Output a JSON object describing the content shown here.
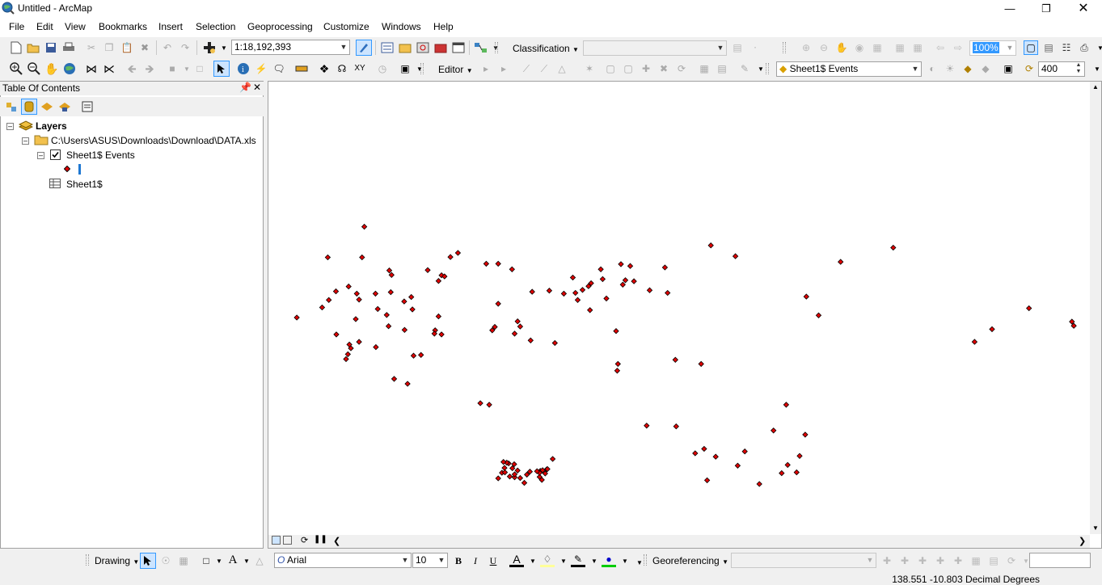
{
  "window": {
    "title": "Untitled - ArcMap",
    "minimize_icon": "minimize-icon",
    "restore_icon": "restore-icon",
    "close_icon": "close-icon"
  },
  "menu": [
    "File",
    "Edit",
    "View",
    "Bookmarks",
    "Insert",
    "Selection",
    "Geoprocessing",
    "Customize",
    "Windows",
    "Help"
  ],
  "standard_toolbar": {
    "scale": "1:18,192,393"
  },
  "spatial_adjustment": {
    "classification_label": "Classification",
    "georef_zoom": "100%"
  },
  "editor": {
    "label": "Editor"
  },
  "effects": {
    "layer": "Sheet1$ Events",
    "value": "400"
  },
  "toc": {
    "title": "Table Of Contents",
    "root": "Layers",
    "source_path": "C:\\Users\\ASUS\\Downloads\\Download\\DATA.xls",
    "layer": "Sheet1$ Events",
    "table": "Sheet1$"
  },
  "drawing": {
    "label": "Drawing",
    "font": "Arial",
    "size": "10",
    "bold": "B",
    "italic": "I",
    "underline": "U",
    "font_color_glyph": "A"
  },
  "georef": {
    "label": "Georeferencing"
  },
  "status": {
    "coordinates": "138.551  -10.803 Decimal Degrees"
  },
  "colors": {
    "point_fill": "#e00000",
    "point_stroke": "#000000",
    "highlight": "#3399ff"
  },
  "map_points": [
    [
      -124.3,
      49.2
    ],
    [
      -134.1,
      41.0
    ],
    [
      -124.9,
      41.0
    ],
    [
      -91.6,
      39.3
    ],
    [
      -88.4,
      39.3
    ],
    [
      -84.7,
      37.8
    ],
    [
      -60.9,
      37.8
    ],
    [
      -103.6,
      36.2
    ],
    [
      -102.8,
      35.9
    ],
    [
      -117.6,
      37.5
    ],
    [
      -107.3,
      37.6
    ],
    [
      -117.0,
      36.3
    ],
    [
      -55.0,
      33.7
    ],
    [
      -104.4,
      34.7
    ],
    [
      -128.5,
      33.2
    ],
    [
      -126.3,
      31.3
    ],
    [
      -131.9,
      31.9
    ],
    [
      -133.8,
      29.6
    ],
    [
      -121.3,
      31.3
    ],
    [
      -117.2,
      31.7
    ],
    [
      -125.7,
      29.7
    ],
    [
      -111.7,
      30.4
    ],
    [
      -113.6,
      29.2
    ],
    [
      -88.4,
      28.6
    ],
    [
      -142.4,
      24.9
    ],
    [
      -126.6,
      24.5
    ],
    [
      -135.6,
      27.6
    ],
    [
      -120.7,
      27.2
    ],
    [
      -118.3,
      25.6
    ],
    [
      -111.4,
      27.1
    ],
    [
      -104.4,
      25.2
    ],
    [
      -117.8,
      22.6
    ],
    [
      -113.5,
      21.6
    ],
    [
      -105.3,
      21.5
    ],
    [
      -105.5,
      20.6
    ],
    [
      -103.6,
      20.4
    ],
    [
      -82.5,
      22.5
    ],
    [
      -89.3,
      22.4
    ],
    [
      -83.2,
      23.9
    ],
    [
      -131.8,
      20.4
    ],
    [
      -125.7,
      18.4
    ],
    [
      -128.7,
      15.1
    ],
    [
      -109.1,
      14.9
    ],
    [
      -111.1,
      14.7
    ],
    [
      -128.3,
      17.7
    ],
    [
      -127.9,
      16.7
    ],
    [
      -121.2,
      17.0
    ],
    [
      -79.3,
      31.8
    ],
    [
      -74.7,
      32.1
    ],
    [
      -54.3,
      34.9
    ],
    [
      -73.2,
      18.1
    ],
    [
      -67.7,
      31.5
    ],
    [
      -56.5,
      10.7
    ],
    [
      -90.0,
      21.5
    ],
    [
      -84.0,
      20.6
    ],
    [
      -79.7,
      18.8
    ],
    [
      -64.2,
      33.3
    ],
    [
      -99.2,
      42.2
    ],
    [
      -101.2,
      41.1
    ],
    [
      -53.0,
      38.7
    ],
    [
      -43.7,
      38.3
    ],
    [
      -24.8,
      41.3
    ],
    [
      -60.4,
      35.2
    ],
    [
      -56.3,
      12.5
    ],
    [
      -63.5,
      34.1
    ],
    [
      -43.0,
      31.5
    ],
    [
      -52.0,
      34.6
    ],
    [
      -68.4,
      35.6
    ],
    [
      -65.8,
      32.3
    ],
    [
      -67.1,
      29.6
    ],
    [
      -63.8,
      26.9
    ],
    [
      -56.8,
      21.3
    ],
    [
      -129.2,
      13.8
    ],
    [
      -116.3,
      8.5
    ],
    [
      -112.7,
      7.2
    ],
    [
      -93.2,
      2.0
    ],
    [
      -90.8,
      1.6
    ],
    [
      -34.0,
      12.5
    ],
    [
      -48.6,
      -4.0
    ],
    [
      -35.6,
      -11.4
    ],
    [
      -30.1,
      -12.3
    ],
    [
      -32.4,
      -18.6
    ],
    [
      -18.4,
      -19.6
    ],
    [
      -10.8,
      -14.5
    ],
    [
      -12.4,
      -16.7
    ],
    [
      -8.4,
      -16.5
    ],
    [
      -24.2,
      -14.7
    ],
    [
      -22.3,
      -10.9
    ],
    [
      -7.6,
      -12.1
    ],
    [
      -33.2,
      -10.2
    ],
    [
      -6.1,
      -6.4
    ],
    [
      -14.6,
      -5.3
    ],
    [
      -11.2,
      1.6
    ],
    [
      -40.7,
      -4.2
    ],
    [
      -84.0,
      -17.8
    ],
    [
      -81.4,
      -19.3
    ],
    [
      -87.4,
      -16.6
    ],
    [
      -82.5,
      -18.0
    ],
    [
      -88.4,
      -18.1
    ],
    [
      -86.7,
      -15.3
    ],
    [
      -85.6,
      -14.1
    ],
    [
      -80.7,
      -17.1
    ],
    [
      -84.0,
      -17.0
    ],
    [
      -83.2,
      -16.0
    ],
    [
      -86.1,
      -13.9
    ],
    [
      -76.7,
      -18.5
    ],
    [
      -75.8,
      -16.8
    ],
    [
      -77.3,
      -17.7
    ],
    [
      -75.4,
      -15.7
    ],
    [
      -86.6,
      -16.5
    ],
    [
      -87.0,
      -13.7
    ],
    [
      -84.6,
      -15.4
    ],
    [
      -85.3,
      -17.6
    ],
    [
      -77.1,
      -16.1
    ],
    [
      -73.8,
      -12.9
    ],
    [
      -77.3,
      -16.6
    ],
    [
      -76.5,
      -15.9
    ],
    [
      -78.0,
      -16.2
    ],
    [
      -79.9,
      -16.3
    ],
    [
      -84.1,
      -14.3
    ],
    [
      -75.2,
      -15.6
    ],
    [
      -59.4,
      30.0
    ],
    [
      -31.4,
      44.2
    ],
    [
      -2.5,
      25.5
    ],
    [
      -40.9,
      13.6
    ],
    [
      -5.8,
      30.5
    ],
    [
      3.4,
      39.8
    ],
    [
      17.5,
      43.6
    ],
    [
      -70.8,
      31.3
    ],
    [
      -55.5,
      39.2
    ],
    [
      44.0,
      21.8
    ],
    [
      53.9,
      27.4
    ],
    [
      65.4,
      23.8
    ],
    [
      65.9,
      22.7
    ],
    [
      39.3,
      18.4
    ],
    [
      -47.8,
      32.2
    ]
  ]
}
